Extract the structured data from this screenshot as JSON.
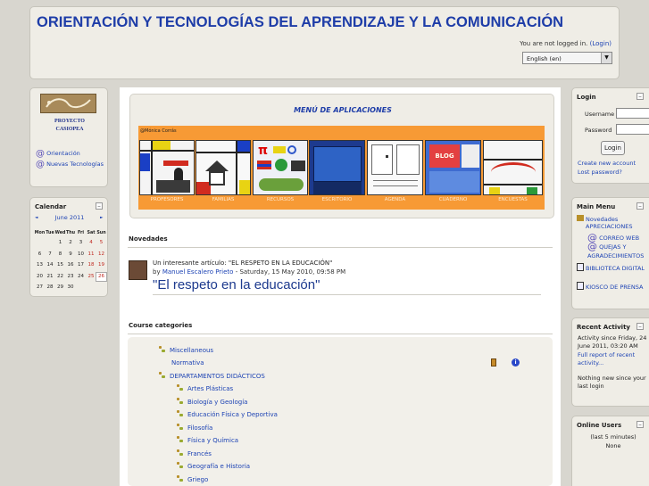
{
  "header": {
    "title": "ORIENTACIÓN Y TECNOLOGÍAS DEL APRENDIZAJE Y LA COMUNICACIÓN",
    "login_status": "You are not logged in.",
    "login_link": "(Login)",
    "language": "English (en)"
  },
  "left": {
    "logo_text_1": "PROYECTO",
    "logo_text_2": "CASIOPEA",
    "links": [
      "Orientación",
      "Nuevas Tecnologías"
    ],
    "calendar": {
      "title": "Calendar",
      "month": "June 2011",
      "prev": "◄",
      "next": "►",
      "weekdays": [
        "Mon",
        "Tue",
        "Wed",
        "Thu",
        "Fri",
        "Sat",
        "Sun"
      ],
      "weeks": [
        [
          "",
          "",
          "1",
          "2",
          "3",
          "4",
          "5"
        ],
        [
          "6",
          "7",
          "8",
          "9",
          "10",
          "11",
          "12"
        ],
        [
          "13",
          "14",
          "15",
          "16",
          "17",
          "18",
          "19"
        ],
        [
          "20",
          "21",
          "22",
          "23",
          "24",
          "25",
          "26"
        ],
        [
          "27",
          "28",
          "29",
          "30",
          "",
          "",
          ""
        ]
      ]
    }
  },
  "main": {
    "menu_title": "MENÚ DE APLICACIONES",
    "banner_credit": "@Mónica Corrás",
    "apps": [
      "PROFESORES",
      "FAMILIAS",
      "RECURSOS",
      "ESCRITORIO",
      "AGENDA",
      "CUADERNO",
      "ENCUESTAS"
    ],
    "blog_tile_text": "BLOG",
    "news_title": "Novedades",
    "post": {
      "subject": "Un interesante artículo: \"EL RESPETO EN LA EDUCACIÓN\"",
      "by": "by",
      "author": "Manuel Escalero Prieto",
      "date": "- Saturday, 15 May 2010, 09:58 PM",
      "headline": "\"El respeto en la educación\""
    },
    "categories_title": "Course categories",
    "categories": [
      {
        "name": "Miscellaneous",
        "icon": true
      },
      {
        "name": "Normativa",
        "icon": false
      },
      {
        "name": "DEPARTAMENTOS DIDÁCTICOS",
        "icon": true
      }
    ],
    "subcategories": [
      "Artes Plásticas",
      "Biología y Geología",
      "Educación Física y Deportiva",
      "Filosofía",
      "Física y Química",
      "Francés",
      "Geografía e Historia",
      "Griego"
    ]
  },
  "right": {
    "login": {
      "title": "Login",
      "username_label": "Username",
      "password_label": "Password",
      "button": "Login",
      "create_account": "Create new account",
      "lost_password": "Lost password?"
    },
    "main_menu": {
      "title": "Main Menu",
      "items": [
        "Novedades",
        "APRECIACIONES",
        "CORREO WEB",
        "QUEJAS Y AGRADECIMIENTOS",
        "BIBLIOTECA DIGITAL",
        "KIOSCO DE PRENSA"
      ]
    },
    "recent": {
      "title": "Recent Activity",
      "since": "Activity since Friday, 24 June 2011, 03:20 AM",
      "full_report": "Full report of recent activity...",
      "nothing": "Nothing new since your last login"
    },
    "online": {
      "title": "Online Users",
      "period": "(last 5 minutes)",
      "none": "None"
    }
  },
  "colors": {
    "title_blue": "#1e3da8",
    "banner_orange": "#f79a35",
    "link_blue": "#1d43b4"
  }
}
